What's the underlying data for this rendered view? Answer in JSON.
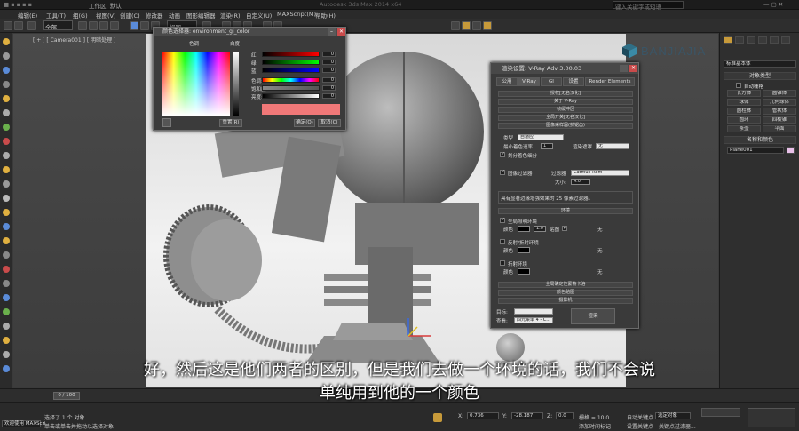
{
  "titlebar": {
    "workspace": "工作区: 默认",
    "app_title": "Autodesk 3ds Max 2014 x64",
    "search_placeholder": "键入关键字或短语"
  },
  "menu": [
    "编辑(E)",
    "工具(T)",
    "组(G)",
    "视图(V)",
    "创建(C)",
    "修改器",
    "动画",
    "图形编辑器",
    "渲染(R)",
    "自定义(U)",
    "MAXScript(M)",
    "帮助(H)"
  ],
  "toolbar": {
    "filter_value": "全部",
    "view_value": "视图"
  },
  "viewport": {
    "label": "[ + ] [ Camera001 ] [ 明暗处理 ]"
  },
  "logo": {
    "text": "BANJIAJIA",
    "color": "#3a5566"
  },
  "right_panel": {
    "dropdown": "标准基本体",
    "object_type_header": "对象类型",
    "autogrid": "自动栅格",
    "objects": [
      "长方体",
      "圆锥体",
      "球体",
      "几何球体",
      "圆柱体",
      "管状体",
      "圆环",
      "四棱锥",
      "茶壶",
      "平面"
    ],
    "name_color_header": "名称和颜色",
    "name_value": "Plane001"
  },
  "color_picker": {
    "title": "颜色选择器: environment_gi_color",
    "hue_label": "色调",
    "white_label": "白度",
    "sliders": [
      {
        "label": "红:",
        "value": "0"
      },
      {
        "label": "绿:",
        "value": "0"
      },
      {
        "label": "蓝:",
        "value": "0"
      },
      {
        "label": "色调:",
        "value": "0"
      },
      {
        "label": "饱和度:",
        "value": "0"
      },
      {
        "label": "亮度:",
        "value": "0"
      }
    ],
    "reset_label": "重置(R)",
    "ok_label": "确定(O)",
    "cancel_label": "取消(C)",
    "swatch_color": "#f07878"
  },
  "vray": {
    "title": "渲染设置: V-Ray Adv 3.00.03",
    "tabs": [
      "公用",
      "V-Ray",
      "GI",
      "设置",
      "Render Elements"
    ],
    "rollouts": [
      "授权[无名汉化]",
      "关于 V-Ray",
      "帧缓冲区",
      "全局开关[无名汉化]",
      "图像采样器(抗锯齿)"
    ],
    "sampler_type_label": "类型",
    "sampler_type_value": "自适应",
    "min_shading_label": "最小着色速率",
    "min_shading_value": "1",
    "render_mask_label": "渲染遮罩",
    "render_mask_value": "无",
    "divide_shading_label": "划分着色细分",
    "filter_label": "图像过滤器",
    "filter_type_label": "过滤器",
    "filter_type_value": "Catmull-Rom",
    "size_label": "大小:",
    "size_value": "4.0",
    "filter_desc": "具有显著边缘增强效果的 25 像素过滤器。",
    "environment_header": "环境",
    "gi_env_label": "全局照明环境",
    "color_label": "颜色",
    "multiplier_value": "1.0",
    "map_label": "贴图",
    "none_label": "无",
    "refl_env_label": "反射/折射环境",
    "refr_env_label": "折射环境",
    "color_mapping": "全局确定性蒙特卡洛",
    "color_map2": "颜色贴图",
    "camera": "摄影机",
    "target_label": "目标:",
    "preset_label": "预设:",
    "view_label": "查看:",
    "view_value": "四元菜单 4 - C...",
    "render_label": "渲染"
  },
  "timeline": {
    "frame": "0 / 100"
  },
  "status": {
    "selected": "选择了 1 个 对象",
    "prompt": "单击或单击并拖动以选择对象",
    "welcome": "欢迎使用 MAXScri",
    "x_label": "X:",
    "x_value": "0.736",
    "y_label": "Y:",
    "y_value": "-28.187",
    "z_label": "Z:",
    "z_value": "0.0",
    "grid": "栅格 = 10.0",
    "autokey": "自动关键点",
    "select_obj": "选定对象",
    "setkey": "设置关键点",
    "keyfilter": "关键点过滤器...",
    "add_time_tag": "添加时间标记"
  },
  "subtitles": {
    "line1": "好，然后这是他们两者的区别，但是我们去做一个环境的话，我们不会说",
    "line2": "单纯用到他的一个颜色"
  }
}
